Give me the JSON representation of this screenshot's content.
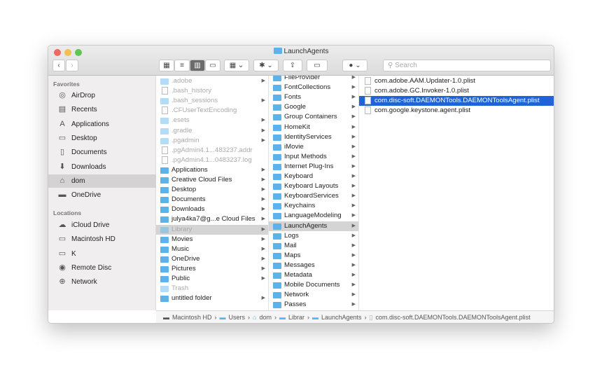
{
  "window": {
    "title": "LaunchAgents",
    "search_placeholder": "Search"
  },
  "colors": {
    "accent": "#1f63d6",
    "folder": "#5cb2ea",
    "close": "#ed6a5e",
    "minimize": "#f5bf4f",
    "zoom": "#61c554"
  },
  "sidebar": {
    "favorites_label": "Favorites",
    "favorites": [
      {
        "label": "AirDrop",
        "icon": "airdrop-icon"
      },
      {
        "label": "Recents",
        "icon": "recents-icon"
      },
      {
        "label": "Applications",
        "icon": "applications-icon"
      },
      {
        "label": "Desktop",
        "icon": "desktop-icon"
      },
      {
        "label": "Documents",
        "icon": "documents-icon"
      },
      {
        "label": "Downloads",
        "icon": "downloads-icon"
      },
      {
        "label": "dom",
        "icon": "home-icon",
        "selected": true
      },
      {
        "label": "OneDrive",
        "icon": "folder-icon"
      }
    ],
    "locations_label": "Locations",
    "locations": [
      {
        "label": "iCloud Drive",
        "icon": "cloud-icon"
      },
      {
        "label": "Macintosh HD",
        "icon": "disk-icon"
      },
      {
        "label": "K",
        "icon": "disk-icon"
      },
      {
        "label": "Remote Disc",
        "icon": "disc-icon"
      },
      {
        "label": "Network",
        "icon": "globe-icon"
      }
    ]
  },
  "columns": [
    [
      {
        "n": ".adobe",
        "t": "f",
        "h": 1,
        "a": 1
      },
      {
        "n": ".bash_history",
        "t": "d",
        "h": 1
      },
      {
        "n": ".bash_sessions",
        "t": "f",
        "h": 1,
        "a": 1
      },
      {
        "n": ".CFUserTextEncoding",
        "t": "d",
        "h": 1
      },
      {
        "n": ".esets",
        "t": "f",
        "h": 1,
        "a": 1
      },
      {
        "n": ".gradle",
        "t": "f",
        "h": 1,
        "a": 1
      },
      {
        "n": ".pgadmin",
        "t": "f",
        "h": 1,
        "a": 1
      },
      {
        "n": ".pgAdmin4.1...483237.addr",
        "t": "d",
        "h": 1
      },
      {
        "n": ".pgAdmin4.1...0483237.log",
        "t": "d",
        "h": 1
      },
      {
        "n": "Applications",
        "t": "f",
        "a": 1
      },
      {
        "n": "Creative Cloud Files",
        "t": "f",
        "a": 1
      },
      {
        "n": "Desktop",
        "t": "f",
        "a": 1
      },
      {
        "n": "Documents",
        "t": "f",
        "a": 1
      },
      {
        "n": "Downloads",
        "t": "f",
        "a": 1
      },
      {
        "n": "julya4ka7@g...e Cloud Files",
        "t": "f",
        "a": 1
      },
      {
        "n": "Library",
        "t": "f",
        "h": 1,
        "a": 1,
        "s": "gray"
      },
      {
        "n": "Movies",
        "t": "f",
        "a": 1
      },
      {
        "n": "Music",
        "t": "f",
        "a": 1
      },
      {
        "n": "OneDrive",
        "t": "f",
        "a": 1
      },
      {
        "n": "Pictures",
        "t": "f",
        "a": 1
      },
      {
        "n": "Public",
        "t": "f",
        "a": 1
      },
      {
        "n": "Trash",
        "t": "f",
        "h": 1
      },
      {
        "n": "untitled folder",
        "t": "f",
        "a": 1
      }
    ],
    [
      {
        "n": "FileProvider",
        "t": "f",
        "a": 1
      },
      {
        "n": "FontCollections",
        "t": "f",
        "a": 1
      },
      {
        "n": "Fonts",
        "t": "f",
        "a": 1
      },
      {
        "n": "Google",
        "t": "f",
        "a": 1
      },
      {
        "n": "Group Containers",
        "t": "f",
        "a": 1
      },
      {
        "n": "HomeKit",
        "t": "f",
        "a": 1
      },
      {
        "n": "IdentityServices",
        "t": "f",
        "a": 1
      },
      {
        "n": "iMovie",
        "t": "f",
        "a": 1
      },
      {
        "n": "Input Methods",
        "t": "f",
        "a": 1
      },
      {
        "n": "Internet Plug-Ins",
        "t": "f",
        "a": 1
      },
      {
        "n": "Keyboard",
        "t": "f",
        "a": 1
      },
      {
        "n": "Keyboard Layouts",
        "t": "f",
        "a": 1
      },
      {
        "n": "KeyboardServices",
        "t": "f",
        "a": 1
      },
      {
        "n": "Keychains",
        "t": "f",
        "a": 1
      },
      {
        "n": "LanguageModeling",
        "t": "f",
        "a": 1
      },
      {
        "n": "LaunchAgents",
        "t": "f",
        "a": 1,
        "s": "gray"
      },
      {
        "n": "Logs",
        "t": "f",
        "a": 1
      },
      {
        "n": "Mail",
        "t": "f",
        "a": 1
      },
      {
        "n": "Maps",
        "t": "f",
        "a": 1
      },
      {
        "n": "Messages",
        "t": "f",
        "a": 1
      },
      {
        "n": "Metadata",
        "t": "f",
        "a": 1
      },
      {
        "n": "Mobile Documents",
        "t": "f",
        "a": 1
      },
      {
        "n": "Network",
        "t": "f",
        "a": 1
      },
      {
        "n": "Passes",
        "t": "f",
        "a": 1
      }
    ],
    [
      {
        "n": "com.adobe.AAM.Updater-1.0.plist",
        "t": "d"
      },
      {
        "n": "com.adobe.GC.Invoker-1.0.plist",
        "t": "d"
      },
      {
        "n": "com.disc-soft.DAEMONTools.DAEMONToolsAgent.plist",
        "t": "d",
        "s": "blue"
      },
      {
        "n": "com.google.keystone.agent.plist",
        "t": "d"
      }
    ]
  ],
  "path_bar": [
    "Macintosh HD",
    "Users",
    "dom",
    "Librar",
    "LaunchAgents",
    "com.disc-soft.DAEMONTools.DAEMONToolsAgent.plist"
  ]
}
